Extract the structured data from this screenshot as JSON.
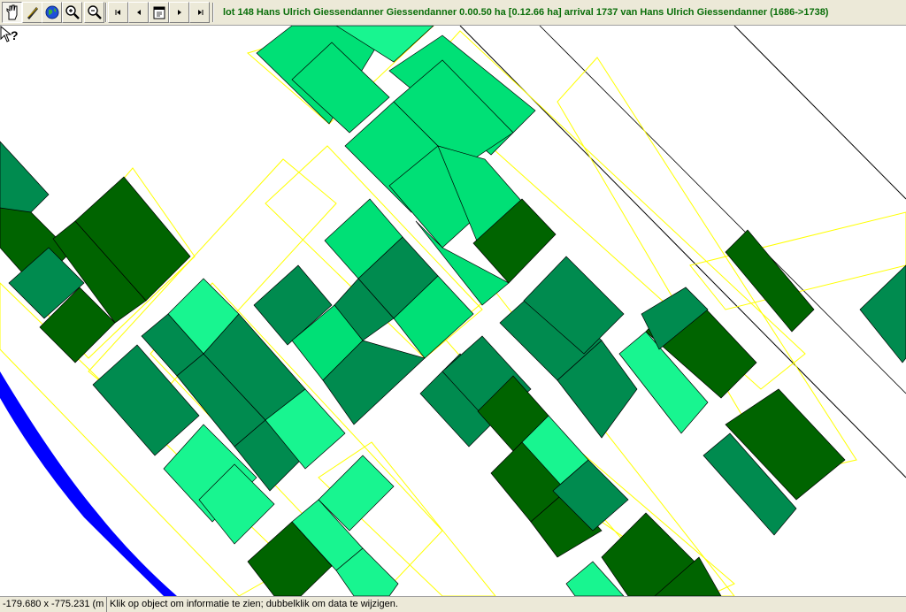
{
  "toolbar": {
    "tools": [
      {
        "name": "pan-tool-button",
        "icon": "hand-icon",
        "pressed": true
      },
      {
        "name": "measure-tool-button",
        "icon": "ruler-icon",
        "pressed": false
      },
      {
        "name": "full-extent-button",
        "icon": "globe-icon",
        "pressed": false
      },
      {
        "name": "zoom-in-button",
        "icon": "zoom-in-icon",
        "pressed": false
      },
      {
        "name": "zoom-out-button",
        "icon": "zoom-out-icon",
        "pressed": false
      },
      {
        "name": "first-button",
        "icon": "first-icon",
        "pressed": false
      },
      {
        "name": "previous-button",
        "icon": "previous-icon",
        "pressed": false
      },
      {
        "name": "calendar-button",
        "icon": "calendar-icon",
        "pressed": false
      },
      {
        "name": "next-button",
        "icon": "next-icon",
        "pressed": false
      },
      {
        "name": "last-button",
        "icon": "last-icon",
        "pressed": false
      }
    ],
    "info_text": "lot 148 Hans Ulrich Giessendanner Giessendanner 0.00.50 ha [0.12.66 ha] arrival 1737 van Hans Ulrich Giessendanner (1686->1738)"
  },
  "map": {
    "cursor_icon": "help-pointer-icon",
    "colors": {
      "background": "#ffffff",
      "lot_dark": "#006400",
      "lot_medium": "#008b4f",
      "lot_light": "#00e076",
      "lot_bright": "#18f590",
      "lot_outline": "#ffff00",
      "river": "#0000ff",
      "road_line": "#000000"
    }
  },
  "status": {
    "coordinates": "-179.680 x -775.231 (m",
    "message": "Klik op object om informatie te zien; dubbelklik om data te wijzigen."
  }
}
